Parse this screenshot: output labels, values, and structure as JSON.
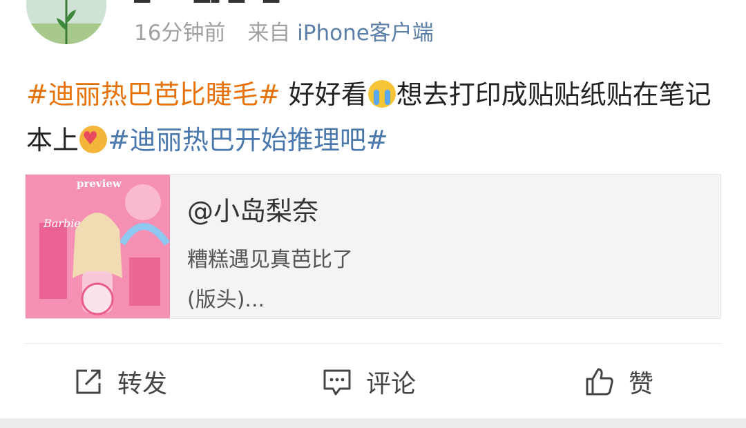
{
  "post": {
    "time": "16分钟前",
    "source_prefix": "来自",
    "device": "iPhone客户端",
    "text": {
      "topic1": "#迪丽热巴芭比睫毛#",
      "part1": " 好好看",
      "emoji1": "crying-face",
      "part2": "想去打印成贴贴纸贴在笔记本上",
      "emoji2": "heart-face",
      "topic2": "#迪丽热巴开始推理吧#"
    },
    "card": {
      "thumbnail_label": "preview",
      "user": "@小岛梨奈",
      "desc_line1": "糟糕遇见真芭比了",
      "desc_line2": "(版头)..."
    }
  },
  "actions": {
    "repost": "转发",
    "comment": "评论",
    "like": "赞"
  },
  "colors": {
    "topic_orange": "#e8720a",
    "topic_blue": "#4a78ad",
    "device_link": "#5b7fa6",
    "thumbnail_pink": "#f58fb3"
  }
}
